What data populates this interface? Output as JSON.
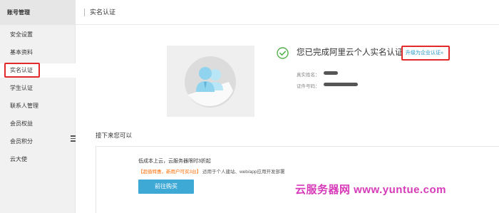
{
  "sidebar": {
    "title": "账号管理",
    "items": [
      {
        "label": "安全设置"
      },
      {
        "label": "基本资料"
      },
      {
        "label": "实名认证"
      },
      {
        "label": "学生认证"
      },
      {
        "label": "联系人管理"
      },
      {
        "label": "会员权益"
      },
      {
        "label": "会员积分"
      },
      {
        "label": "云大使"
      }
    ],
    "active_item": "实名认证"
  },
  "header": {
    "title": "实名认证"
  },
  "verification": {
    "status_text": "您已完成阿里云个人实名认证",
    "upgrade_link": "升级为企业认证»",
    "real_name_label": "真实姓名：",
    "id_number_label": "证件号码："
  },
  "next_steps": {
    "title": "接下来您可以",
    "offer_title": "低成本上云，云服务器限时3折起",
    "offer_highlight": "【超值特惠，新用户可买3台】",
    "offer_desc": "适用于个人建站、web/app应用开发部署",
    "buy_button": "前往购买"
  },
  "watermark": {
    "text": "云服务器网 www.yuntue.com"
  },
  "colors": {
    "sidebar_bg": "#f1f1f1",
    "accent_blue": "#3fa9d6",
    "link_blue": "#2196c4",
    "success_green": "#52b04a",
    "highlight_orange": "#ff6a00",
    "annotation_red": "#e32a2a",
    "watermark_pink": "#d63ab8",
    "avatar_blue": "#8fd3ee"
  },
  "icons": {
    "status": "check-circle-icon",
    "collapse": "menu-collapse-icon",
    "illustration": "user-card-illustration"
  }
}
